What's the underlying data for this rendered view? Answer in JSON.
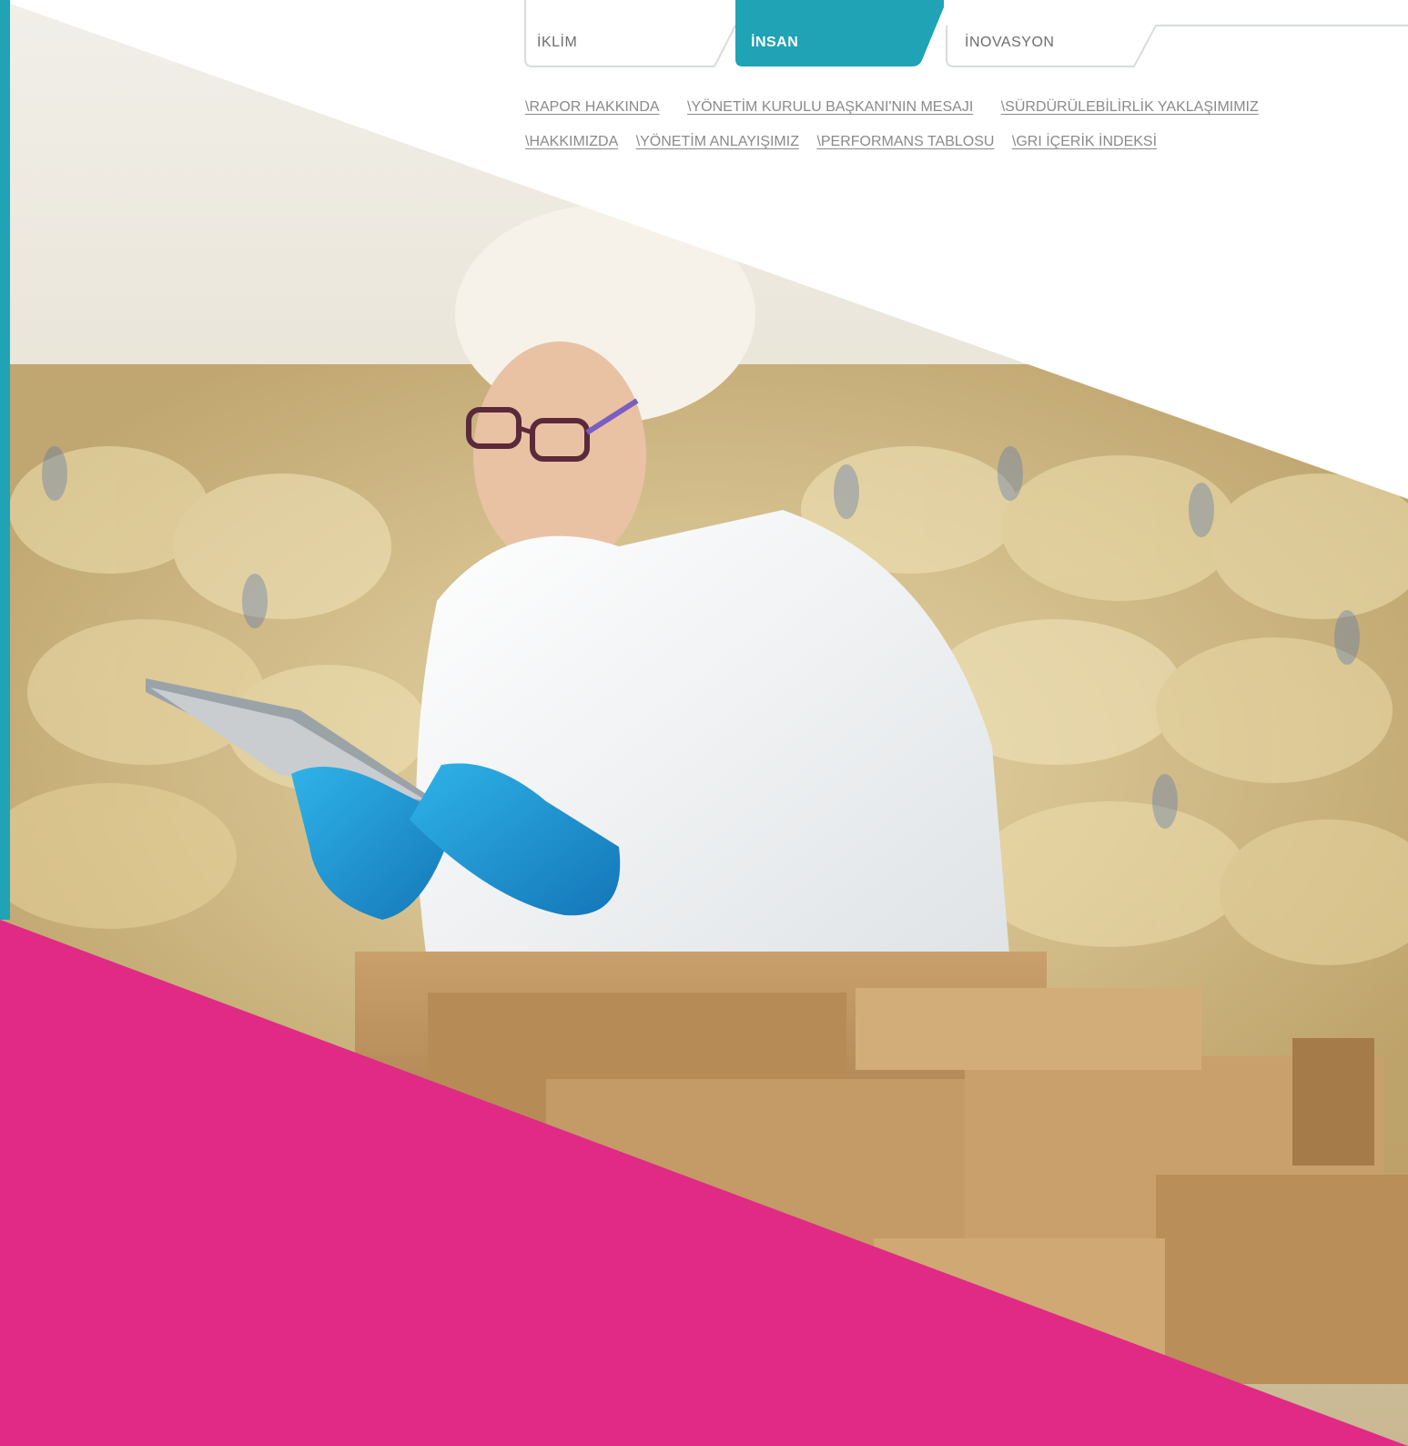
{
  "tabs": [
    {
      "label": "İKLİM",
      "active": false
    },
    {
      "label": "İNSAN",
      "active": true
    },
    {
      "label": "İNOVASYON",
      "active": false
    }
  ],
  "nav": {
    "row1": [
      "\\RAPOR HAKKINDA",
      "\\YÖNETİM KURULU BAŞKANI'NIN MESAJI",
      "\\SÜRDÜRÜLEBİLİRLİK YAKLAŞIMIMIZ"
    ],
    "row2": [
      "\\HAKKIMIZDA",
      "\\YÖNETİM ANLAYIŞIMIZ",
      "\\PERFORMANS TABLOSU",
      "\\GRI İÇERİK İNDEKSİ"
    ]
  },
  "colors": {
    "accent_teal": "#1fa3b5",
    "magenta": "#e02a86",
    "tab_border": "#d7dcdd"
  },
  "hero_image": "worker-with-tablet-in-food-warehouse"
}
